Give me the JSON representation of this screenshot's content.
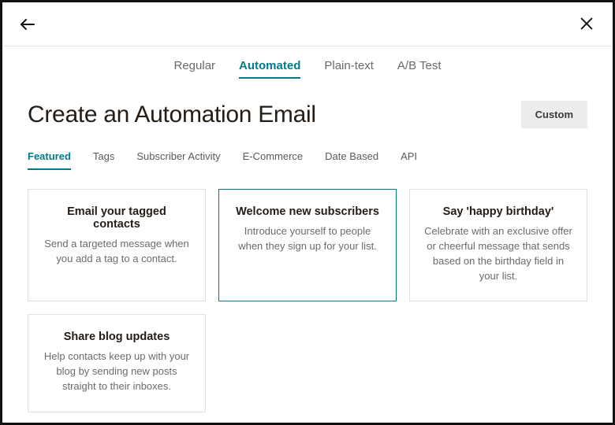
{
  "colors": {
    "accent": "#007c89"
  },
  "topbar": {
    "back_icon": "arrow-left",
    "close_icon": "close"
  },
  "typeTabs": {
    "items": [
      {
        "label": "Regular",
        "active": false
      },
      {
        "label": "Automated",
        "active": true
      },
      {
        "label": "Plain-text",
        "active": false
      },
      {
        "label": "A/B Test",
        "active": false
      }
    ]
  },
  "page": {
    "title": "Create an Automation Email",
    "custom_button": "Custom"
  },
  "subtabs": {
    "items": [
      {
        "label": "Featured",
        "active": true
      },
      {
        "label": "Tags",
        "active": false
      },
      {
        "label": "Subscriber Activity",
        "active": false
      },
      {
        "label": "E-Commerce",
        "active": false
      },
      {
        "label": "Date Based",
        "active": false
      },
      {
        "label": "API",
        "active": false
      }
    ]
  },
  "cards": [
    {
      "title": "Email your tagged contacts",
      "desc": "Send a targeted message when you add a tag to a contact.",
      "selected": false
    },
    {
      "title": "Welcome new subscribers",
      "desc": "Introduce yourself to people when they sign up for your list.",
      "selected": true
    },
    {
      "title": "Say 'happy birthday'",
      "desc": "Celebrate with an exclusive offer or cheerful message that sends based on the birthday field in your list.",
      "selected": false
    },
    {
      "title": "Share blog updates",
      "desc": "Help contacts keep up with your blog by sending new posts straight to their inboxes.",
      "selected": false
    }
  ]
}
